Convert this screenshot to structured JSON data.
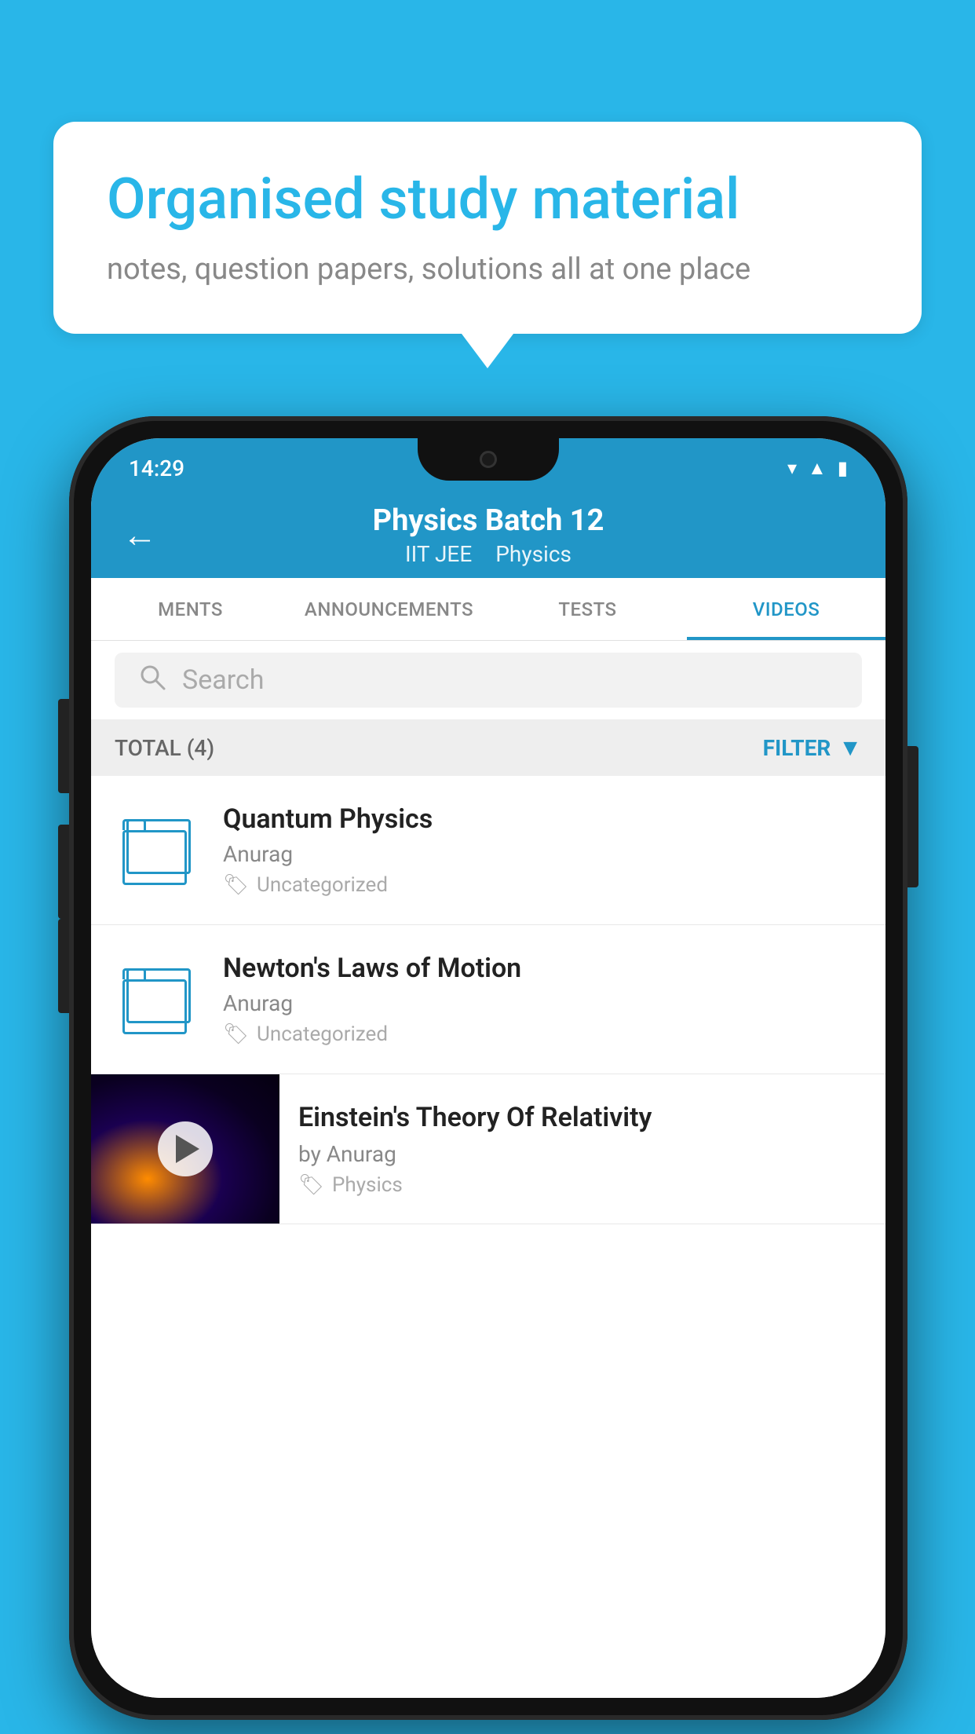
{
  "background_color": "#29b6e8",
  "bubble": {
    "title": "Organised study material",
    "subtitle": "notes, question papers, solutions all at one place"
  },
  "status_bar": {
    "time": "14:29",
    "icons": [
      "wifi",
      "signal",
      "battery"
    ]
  },
  "header": {
    "title": "Physics Batch 12",
    "subtitle1": "IIT JEE",
    "subtitle2": "Physics",
    "back_label": "←"
  },
  "tabs": [
    {
      "label": "MENTS",
      "active": false
    },
    {
      "label": "ANNOUNCEMENTS",
      "active": false
    },
    {
      "label": "TESTS",
      "active": false
    },
    {
      "label": "VIDEOS",
      "active": true
    }
  ],
  "search": {
    "placeholder": "Search"
  },
  "filter_bar": {
    "total_label": "TOTAL (4)",
    "filter_label": "FILTER"
  },
  "items": [
    {
      "type": "folder",
      "title": "Quantum Physics",
      "author": "Anurag",
      "tag": "Uncategorized"
    },
    {
      "type": "folder",
      "title": "Newton's Laws of Motion",
      "author": "Anurag",
      "tag": "Uncategorized"
    },
    {
      "type": "video",
      "title": "Einstein's Theory Of Relativity",
      "author": "by Anurag",
      "tag": "Physics"
    }
  ]
}
